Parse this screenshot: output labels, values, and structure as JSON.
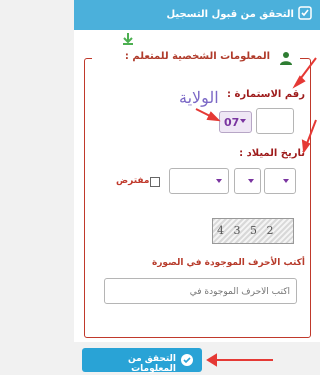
{
  "top_bar": {
    "title": "التحقق من قبول التسجيل",
    "check_icon": "check-square-icon"
  },
  "panel": {
    "download_icon": "download-icon"
  },
  "fieldset": {
    "legend": "المعلومات الشخصية للمتعلم :",
    "user_icon": "user-icon"
  },
  "form": {
    "form_number_label": "رقم الاستمارة :",
    "form_number_value": "",
    "wilaya_annotation": "الولاية",
    "state_value": "07",
    "birth_date_label": "تاريخ الميلاد :",
    "probable_label": "مفترض",
    "captcha_text": "4 3 5 2",
    "letters_label": "أكتب الأحرف الموجودة في الصورة",
    "letters_placeholder": "أكتب الأحرف الموجودة في"
  },
  "actions": {
    "verify_label": "التحقق من المعلومات",
    "verify_icon": "check-circle-icon"
  },
  "colors": {
    "accent": "#29a3d6",
    "label_red": "#9e1b1b",
    "annotation": "#e53935"
  }
}
